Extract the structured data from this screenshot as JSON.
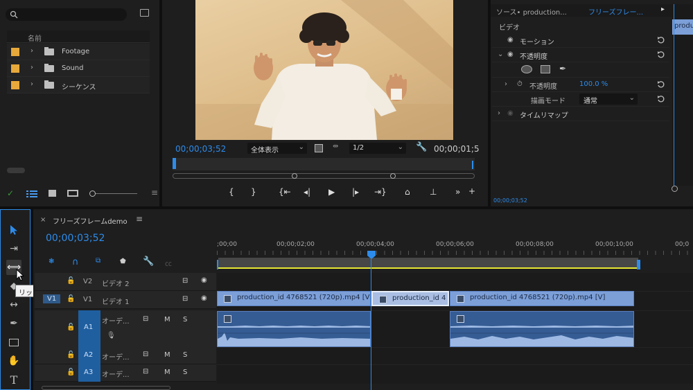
{
  "project": {
    "search_placeholder": "",
    "column_name": "名前",
    "items": [
      {
        "label": "Footage",
        "color": "#e7a93b"
      },
      {
        "label": "Sound",
        "color": "#e7a93b"
      },
      {
        "label": "シーケンス",
        "color": "#e7a93b"
      }
    ]
  },
  "program": {
    "timecode": "00;00;03;52",
    "zoom": "全体表示",
    "resolution": "1/2",
    "duration": "00;00;01;5"
  },
  "effect_controls": {
    "tab_source": "ソース• production...",
    "tab_active": "フリーズフレー...",
    "section": "ビデオ",
    "motion": "モーション",
    "opacity": "不透明度",
    "opacity_param": "不透明度",
    "opacity_value": "100.0 %",
    "blend_mode_label": "描画モード",
    "blend_mode_value": "通常",
    "time_remap": "タイムリマップ",
    "clip_stub": "produ",
    "timecode": "00;00;03;52"
  },
  "timeline": {
    "close": "×",
    "sequence_name": "フリーズフレームdemo",
    "timecode": "00;00;03;52",
    "ruler": [
      ";00;00",
      "00;00;02;00",
      "00;00;04;00",
      "00;00;06;00",
      "00;00;08;00",
      "00;00;10;00",
      "00;0"
    ],
    "tracks": {
      "v2": {
        "id": "V2",
        "name": "ビデオ 2"
      },
      "v1": {
        "src": "V1",
        "id": "V1",
        "name": "ビデオ 1"
      },
      "a1": {
        "id": "A1",
        "name": "オーデ..."
      },
      "a2": {
        "id": "A2",
        "name": "オーデ..."
      },
      "a3": {
        "id": "A3",
        "name": "オーデ..."
      },
      "m": "M",
      "s": "S"
    },
    "clips": {
      "v1_a": "production_id 4768521 (720p).mp4 [V",
      "v1_b": "production_id 4",
      "v1_c": "production_id 4768521 (720p).mp4 [V]"
    },
    "tooltip": "リップルツール (B)"
  },
  "colors": {
    "accent": "#2d8ceb",
    "clip_video": "#7c9fd8",
    "clip_audio": "#365c94",
    "folder_label": "#e7a93b",
    "work_area": "#e8e832"
  }
}
